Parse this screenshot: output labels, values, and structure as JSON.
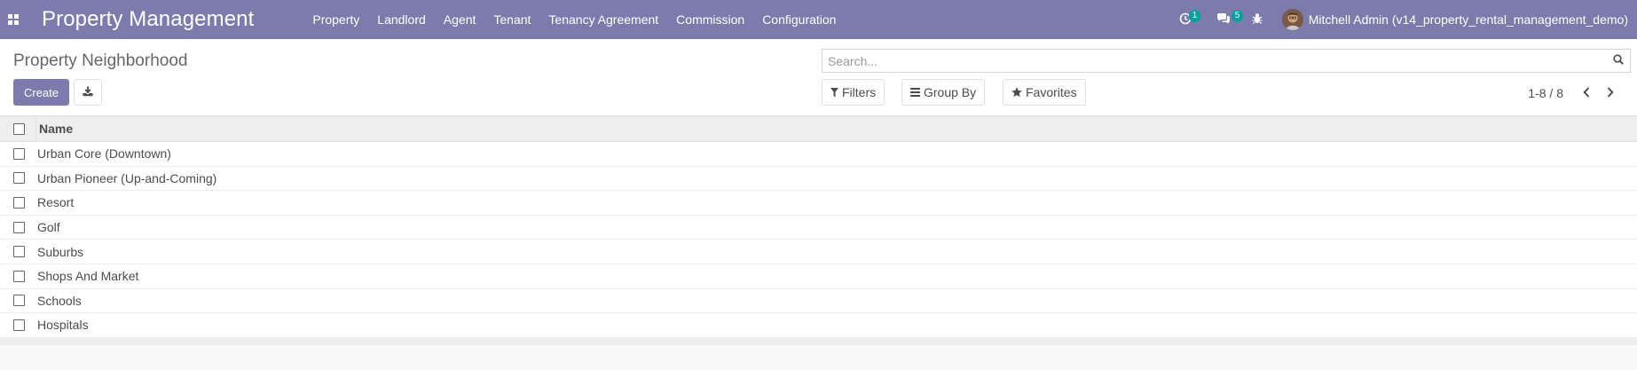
{
  "navbar": {
    "brand": "Property Management",
    "menu": [
      {
        "label": "Property"
      },
      {
        "label": "Landlord"
      },
      {
        "label": "Agent"
      },
      {
        "label": "Tenant"
      },
      {
        "label": "Tenancy Agreement"
      },
      {
        "label": "Commission"
      },
      {
        "label": "Configuration"
      }
    ],
    "activity_count": "1",
    "messages_count": "5",
    "user_name": "Mitchell Admin (v14_property_rental_management_demo)",
    "bg_color": "#7c7bad",
    "badge_color": "#00a09d"
  },
  "control_panel": {
    "title": "Property Neighborhood",
    "create_label": "Create",
    "search_placeholder": "Search...",
    "filters_label": "Filters",
    "group_by_label": "Group By",
    "favorites_label": "Favorites",
    "pager_value": "1-8 / 8"
  },
  "list": {
    "column_name": "Name",
    "rows": [
      {
        "name": "Urban Core (Downtown)"
      },
      {
        "name": "Urban Pioneer (Up-and-Coming)"
      },
      {
        "name": "Resort"
      },
      {
        "name": "Golf"
      },
      {
        "name": "Suburbs"
      },
      {
        "name": "Shops And Market"
      },
      {
        "name": "Schools"
      },
      {
        "name": "Hospitals"
      }
    ]
  }
}
